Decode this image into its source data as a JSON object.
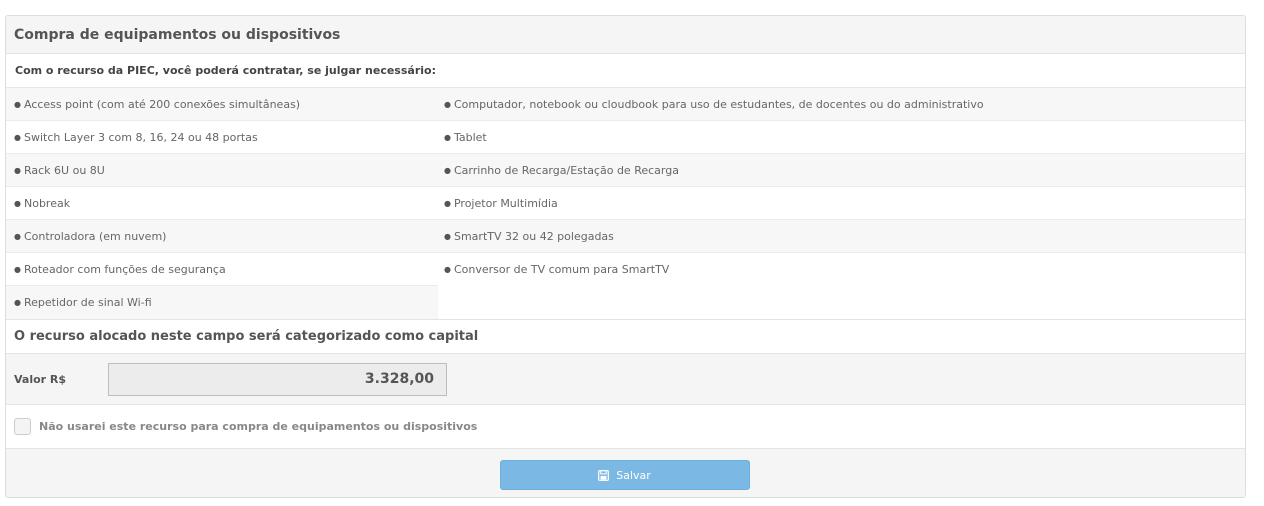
{
  "panel": {
    "title": "Compra de equipamentos ou dispositivos",
    "intro": "Com o recurso da PIEC, você poderá contratar, se julgar necessário:"
  },
  "items_left": [
    "Access point (com até 200 conexões simultâneas)",
    "Switch Layer 3 com 8, 16, 24 ou 48 portas",
    "Rack 6U ou 8U",
    "Nobreak",
    "Controladora (em nuvem)",
    "Roteador com funções de segurança",
    "Repetidor de sinal Wi-fi"
  ],
  "items_right": [
    "Computador, notebook ou cloudbook para uso de estudantes, de docentes ou do administrativo",
    "Tablet",
    "Carrinho de Recarga/Estação de Recarga",
    "Projetor Multimídia",
    "SmartTV 32 ou 42 polegadas",
    "Conversor de TV comum para SmartTV"
  ],
  "capital_note": "O recurso alocado neste campo será categorizado como capital",
  "valor": {
    "label": "Valor R$",
    "value": "3.328,00"
  },
  "opt_out": {
    "label": "Não usarei este recurso para compra de equipamentos ou dispositivos",
    "checked": false
  },
  "save": {
    "label": "Salvar",
    "icon": "save-icon"
  },
  "colors": {
    "button": "#7cb8e4",
    "header_bg": "#f5f5f5"
  }
}
